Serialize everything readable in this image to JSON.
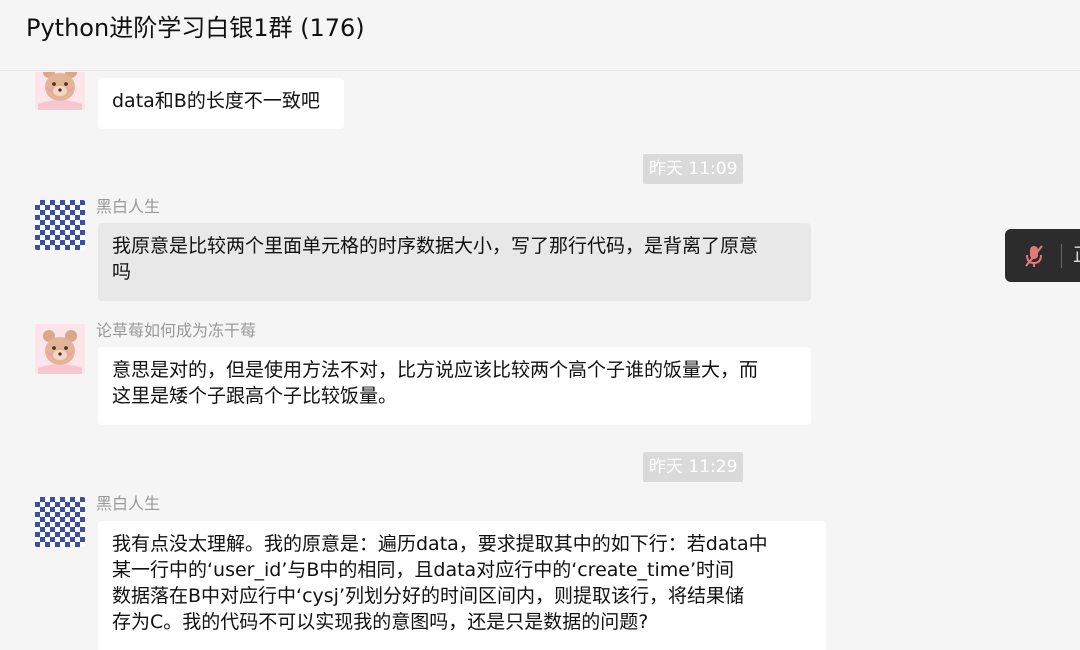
{
  "header": {
    "title": "Python进阶学习白银1群 (176)"
  },
  "messages": [
    {
      "sender": "",
      "text": "data和B的长度不一致吧",
      "avatar_icon": "bear-avatar-icon"
    },
    {
      "timestamp": "昨天 11:09"
    },
    {
      "sender": "黑白人生",
      "lines": [
        "我原意是比较两个里面单元格的时序数据大小，写了那行代码，是背离了原意",
        "吗"
      ],
      "avatar_icon": "checker-avatar-icon"
    },
    {
      "sender": "论草莓如何成为冻干莓",
      "lines": [
        "意思是对的，但是使用方法不对，比方说应该比较两个高个子谁的饭量大，而",
        "这里是矮个子跟高个子比较饭量。"
      ],
      "avatar_icon": "bear-avatar-icon"
    },
    {
      "timestamp": "昨天 11:29"
    },
    {
      "sender": "黑白人生",
      "lines": [
        "我有点没太理解。我的原意是：遍历data，要求提取其中的如下行：若data中",
        "某一行中的‘user_id’与B中的相同，且data对应行中的‘create_time’时间",
        "数据落在B中对应行中‘cysj’列划分好的时间区间内，则提取该行，将结果储",
        "存为C。我的代码不可以实现我的意图吗，还是只是数据的问题?"
      ],
      "avatar_icon": "checker-avatar-icon"
    }
  ],
  "floating_control": {
    "mic_icon": "mic-muted-icon",
    "partial_text": "正"
  }
}
